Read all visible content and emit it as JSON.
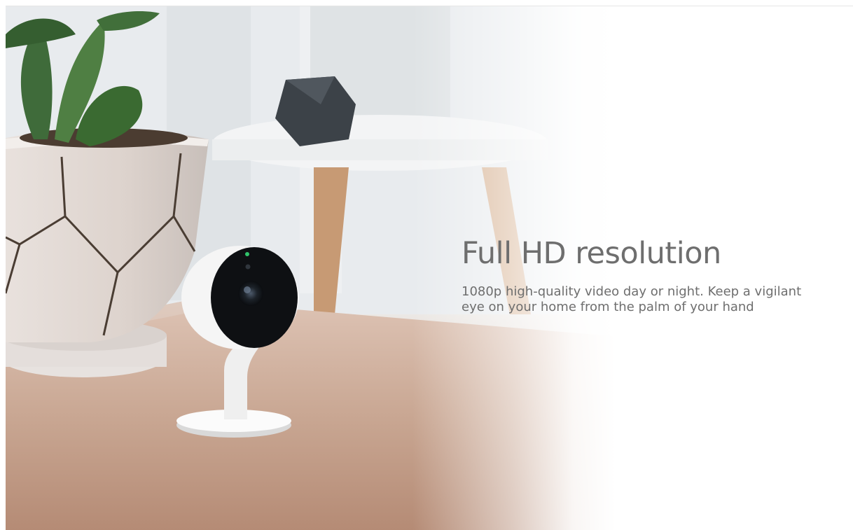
{
  "feature": {
    "headline": "Full HD resolution",
    "description": "1080p high-quality video day or night. Keep a vigilant eye on your home from the palm of your hand"
  },
  "image": {
    "icon": "camera-icon"
  },
  "colors": {
    "text": "#6e6e6e",
    "background": "#ffffff",
    "table_wood": "#c49e89",
    "camera_body": "#f4f4f4"
  }
}
